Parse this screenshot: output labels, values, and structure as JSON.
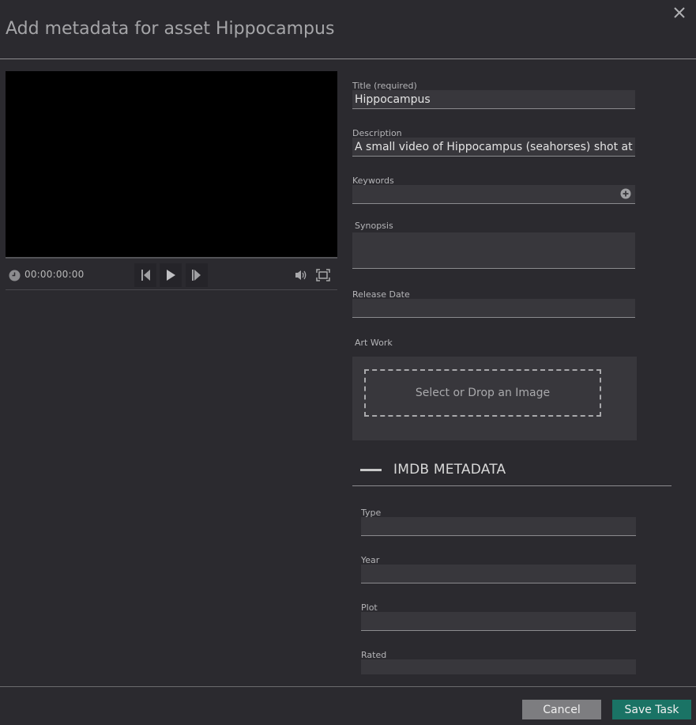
{
  "dialog": {
    "title": "Add metadata for asset Hippocampus",
    "close_icon": "close-icon"
  },
  "player": {
    "timecode": "00:00:00:00",
    "icons": [
      "clock-icon",
      "step-back-icon",
      "play-icon",
      "step-forward-icon",
      "volume-icon",
      "fullscreen-icon"
    ]
  },
  "form": {
    "title": {
      "label": "Title (required)",
      "value": "Hippocampus"
    },
    "description": {
      "label": "Description",
      "value": "A small video of Hippocampus (seahorses) shot at the M"
    },
    "keywords": {
      "label": "Keywords",
      "value": "",
      "add_icon": "plus-circle-icon"
    },
    "synopsis": {
      "label": "Synopsis",
      "value": ""
    },
    "release_date": {
      "label": "Release Date",
      "value": ""
    },
    "artwork": {
      "label": "Art Work",
      "dropzone_text": "Select or Drop an Image"
    }
  },
  "imdb": {
    "section_title": "IMDB METADATA",
    "collapse_icon": "minus-icon",
    "type": {
      "label": "Type",
      "value": ""
    },
    "year": {
      "label": "Year",
      "value": ""
    },
    "plot": {
      "label": "Plot",
      "value": ""
    },
    "rated": {
      "label": "Rated",
      "value": ""
    }
  },
  "footer": {
    "cancel_label": "Cancel",
    "save_label": "Save Task"
  },
  "colors": {
    "background": "#2b2a2f",
    "input_bg": "#38373c",
    "save_button": "#1a7365",
    "cancel_button": "#7d7d80"
  }
}
